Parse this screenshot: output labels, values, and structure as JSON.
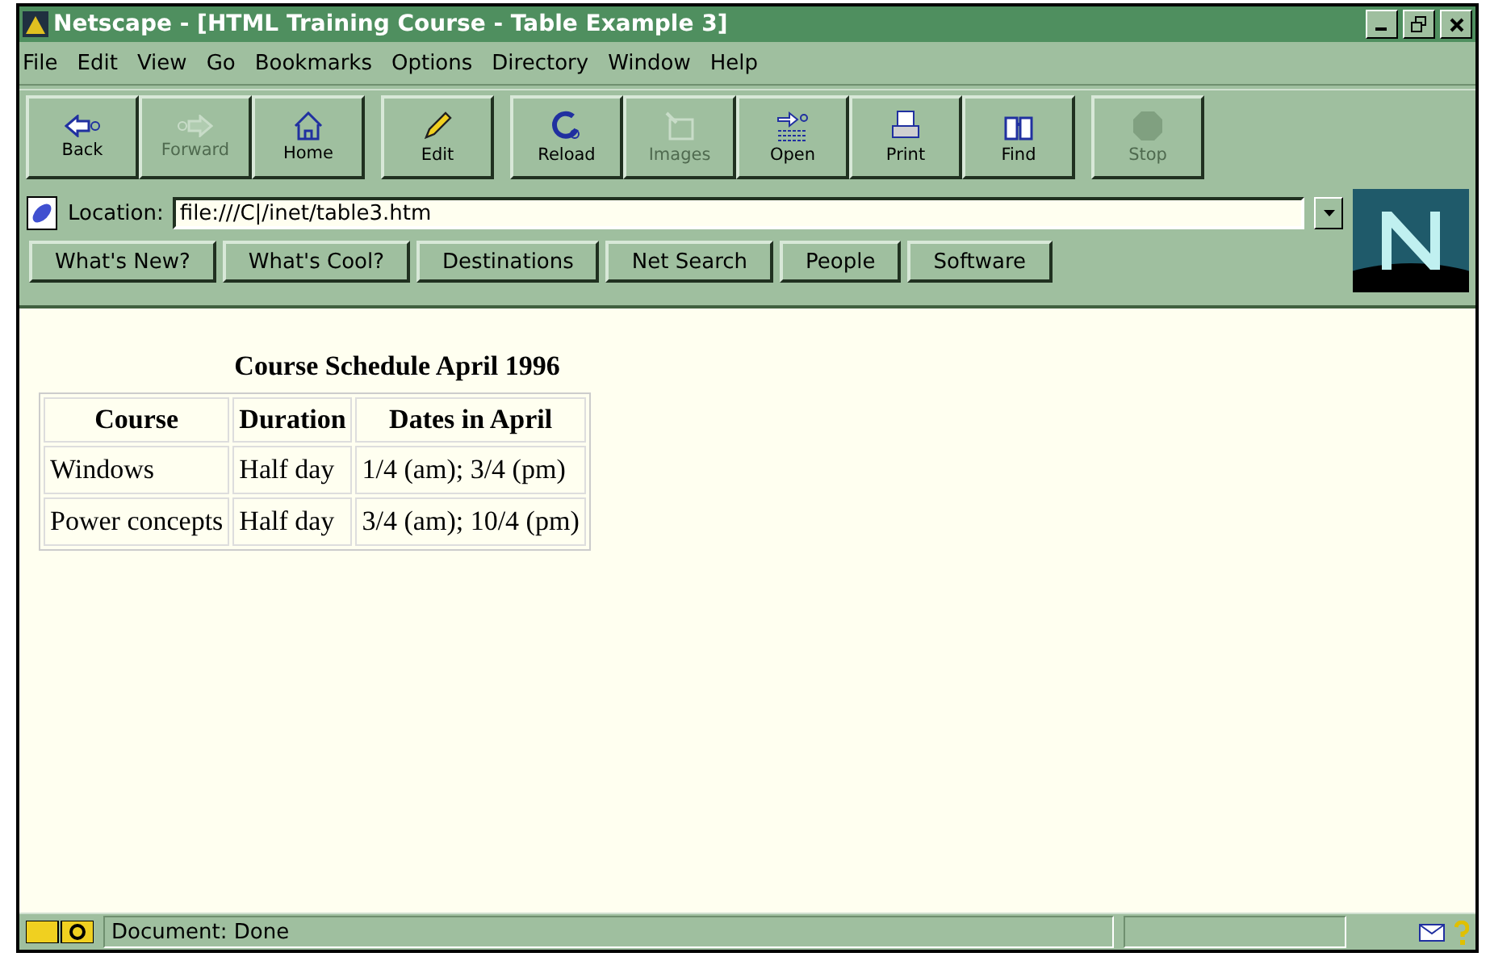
{
  "window": {
    "title": "Netscape - [HTML Training Course - Table Example 3]"
  },
  "menu": [
    "File",
    "Edit",
    "View",
    "Go",
    "Bookmarks",
    "Options",
    "Directory",
    "Window",
    "Help"
  ],
  "toolbar": [
    {
      "buttons": [
        {
          "label": "Back",
          "kind": "back",
          "disabled": false
        },
        {
          "label": "Forward",
          "kind": "forward",
          "disabled": true
        },
        {
          "label": "Home",
          "kind": "home",
          "disabled": false
        }
      ]
    },
    {
      "buttons": [
        {
          "label": "Edit",
          "kind": "edit",
          "disabled": false
        }
      ]
    },
    {
      "buttons": [
        {
          "label": "Reload",
          "kind": "reload",
          "disabled": false
        },
        {
          "label": "Images",
          "kind": "images",
          "disabled": true
        },
        {
          "label": "Open",
          "kind": "open",
          "disabled": false
        },
        {
          "label": "Print",
          "kind": "print",
          "disabled": false
        },
        {
          "label": "Find",
          "kind": "find",
          "disabled": false
        }
      ]
    },
    {
      "buttons": [
        {
          "label": "Stop",
          "kind": "stop",
          "disabled": true
        }
      ]
    }
  ],
  "location": {
    "label": "Location:",
    "value": "file:///C|/inet/table3.htm"
  },
  "directory_buttons": [
    "What's New?",
    "What's Cool?",
    "Destinations",
    "Net Search",
    "People",
    "Software"
  ],
  "page": {
    "table": {
      "caption": "Course Schedule April 1996",
      "columns": [
        "Course",
        "Duration",
        "Dates in April"
      ],
      "rows": [
        [
          "Windows",
          "Half day",
          "1/4 (am); 3/4 (pm)"
        ],
        [
          "Power concepts",
          "Half day",
          "3/4 (am); 10/4 (pm)"
        ]
      ]
    }
  },
  "status_bar": {
    "text": "Document: Done"
  }
}
